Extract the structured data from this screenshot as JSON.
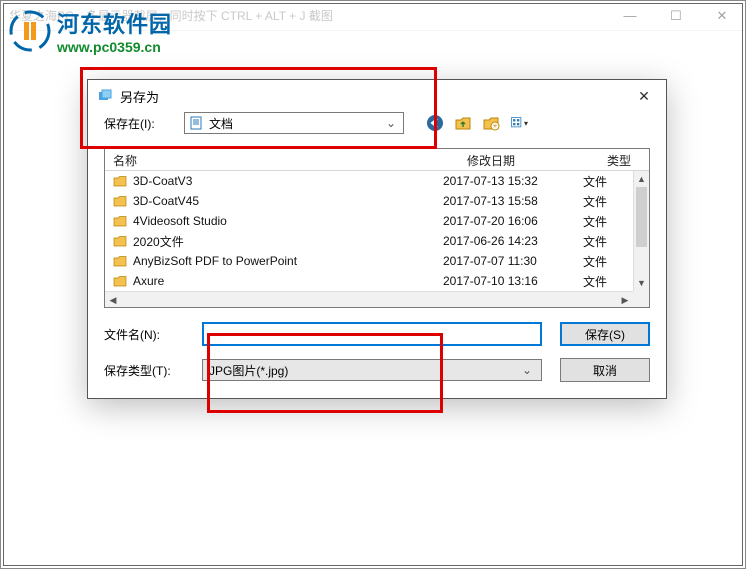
{
  "parent_window": {
    "title": "华夏之海PC，多显示器截屏，同时按下 CTRL + ALT + J 截图",
    "min": "—",
    "max": "☐",
    "close": "✕"
  },
  "watermark": {
    "site_cn": "河东软件园",
    "site_url": "www.pc0359.cn"
  },
  "dialog": {
    "title": "另存为",
    "close": "✕",
    "savein_label": "保存在(I):",
    "savein_value": "文档",
    "columns": {
      "name": "名称",
      "date": "修改日期",
      "type": "类型"
    },
    "rows": [
      {
        "name": "3D-CoatV3",
        "date": "2017-07-13 15:32",
        "type": "文件"
      },
      {
        "name": "3D-CoatV45",
        "date": "2017-07-13 15:58",
        "type": "文件"
      },
      {
        "name": "4Videosoft Studio",
        "date": "2017-07-20 16:06",
        "type": "文件"
      },
      {
        "name": "2020文件",
        "date": "2017-06-26 14:23",
        "type": "文件"
      },
      {
        "name": "AnyBizSoft PDF to PowerPoint",
        "date": "2017-07-07 11:30",
        "type": "文件"
      },
      {
        "name": "Axure",
        "date": "2017-07-10 13:16",
        "type": "文件"
      }
    ],
    "filename_label": "文件名(N):",
    "filename_value": "",
    "filetype_label": "保存类型(T):",
    "filetype_value": "JPG图片(*.jpg)",
    "save_button": "保存(S)",
    "cancel_button": "取消"
  }
}
